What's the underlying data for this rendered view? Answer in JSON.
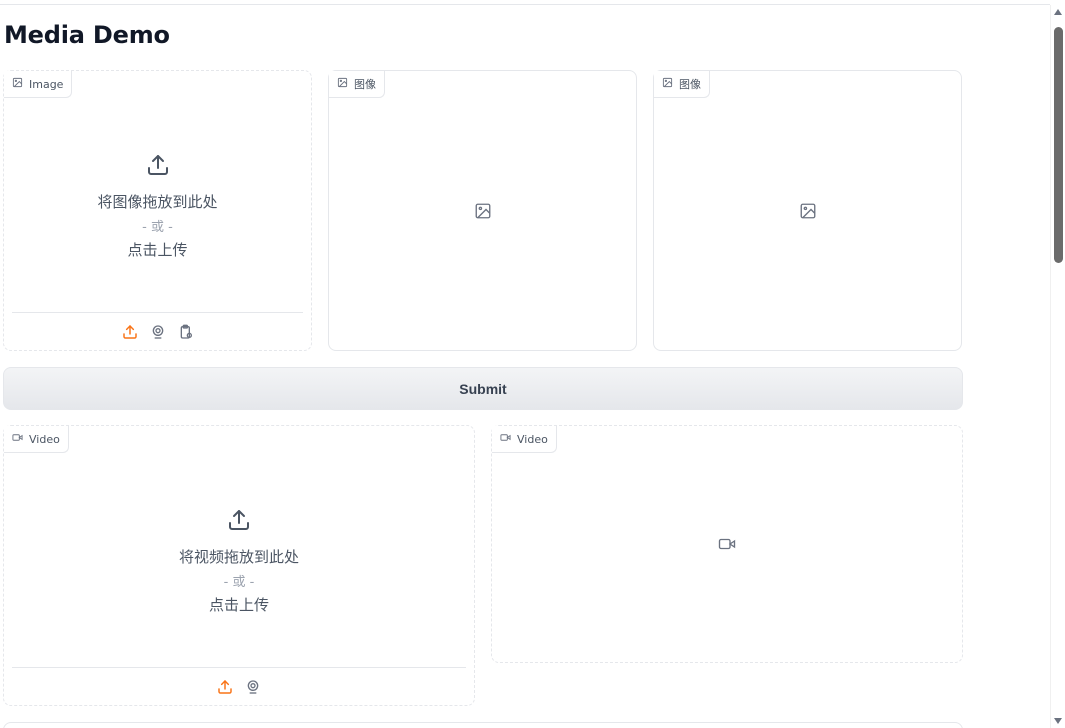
{
  "page": {
    "title": "Media Demo"
  },
  "image_input": {
    "label": "Image",
    "drop_text": "将图像拖放到此处",
    "or_text": "- 或 -",
    "click_text": "点击上传",
    "toolbar_icons": [
      "upload-icon",
      "webcam-icon",
      "clipboard-icon"
    ]
  },
  "image_output_1": {
    "label": "图像",
    "placeholder_icon": "image-icon"
  },
  "image_output_2": {
    "label": "图像",
    "placeholder_icon": "image-icon"
  },
  "submit": {
    "label": "Submit"
  },
  "video_input": {
    "label": "Video",
    "drop_text": "将视频拖放到此处",
    "or_text": "- 或 -",
    "click_text": "点击上传",
    "toolbar_icons": [
      "upload-icon",
      "webcam-icon"
    ]
  },
  "video_output": {
    "label": "Video",
    "placeholder_icon": "video-icon"
  },
  "colors": {
    "accent": "#f97316",
    "icon_gray": "#6b7280",
    "border": "#e5e7eb"
  }
}
